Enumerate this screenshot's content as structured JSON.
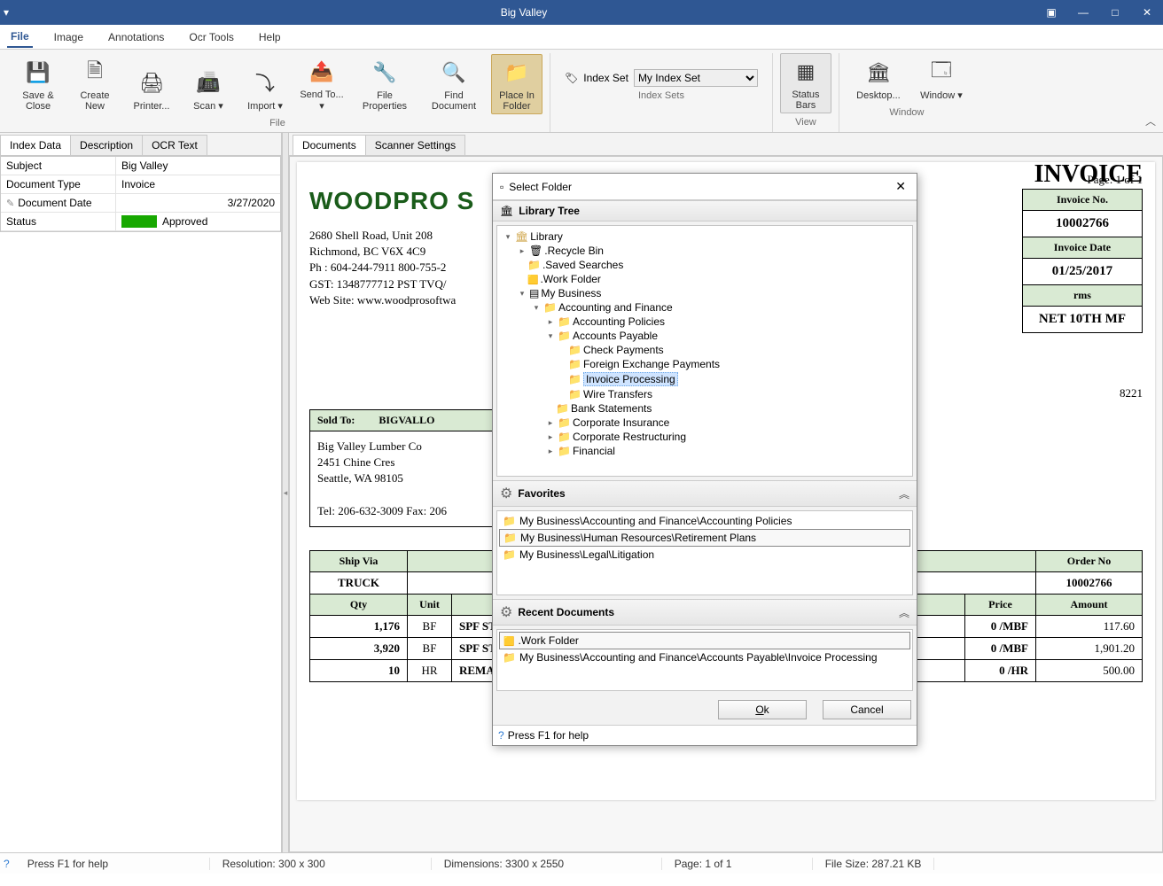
{
  "window": {
    "title": "Big Valley"
  },
  "menu": {
    "file": "File",
    "image": "Image",
    "annotations": "Annotations",
    "ocr": "Ocr Tools",
    "help": "Help"
  },
  "ribbon": {
    "file": {
      "save_close": "Save & Close",
      "create_new": "Create New",
      "printer": "Printer...",
      "scan": "Scan",
      "import": "Import",
      "send_to": "Send To...",
      "file_properties": "File Properties",
      "find_document": "Find Document",
      "place_in_folder": "Place In Folder",
      "group": "File"
    },
    "index": {
      "label": "Index Set",
      "value": "My Index Set",
      "group": "Index Sets"
    },
    "view": {
      "status_bars": "Status Bars",
      "group": "View"
    },
    "window": {
      "desktop": "Desktop...",
      "window": "Window",
      "group": "Window"
    }
  },
  "left_tabs": {
    "index_data": "Index Data",
    "description": "Description",
    "ocr_text": "OCR Text"
  },
  "index_grid": {
    "subject_k": "Subject",
    "subject_v": "Big Valley",
    "doctype_k": "Document Type",
    "doctype_v": "Invoice",
    "docdate_k": "Document Date",
    "docdate_v": "3/27/2020",
    "status_k": "Status",
    "status_v": "Approved"
  },
  "right_tabs": {
    "documents": "Documents",
    "scanner": "Scanner Settings"
  },
  "doc": {
    "pgno": "Page: 1 of 1",
    "logo": "WOODPRO S",
    "inv_heading": "INVOICE",
    "addr1": "2680 Shell Road, Unit 208",
    "addr2": "Richmond, BC  V6X 4C9",
    "addr3": "Ph  : 604-244-7911  800-755-2",
    "addr4": "GST: 1348777712   PST TVQ/",
    "addr5": "Web Site: www.woodprosoftwa",
    "inv_no_h": "Invoice No.",
    "inv_no": "10002766",
    "inv_date_h": "Invoice Date",
    "inv_date": "01/25/2017",
    "terms_h": "rms",
    "terms": "NET 10TH MF",
    "acct": "8221",
    "soldto_h": "Sold To:",
    "soldto_code": "BIGVALLO",
    "soldto_name": "Big Valley Lumber Co",
    "soldto_a1": "2451 Chine Cres",
    "soldto_a2": "Seattle, WA 98105",
    "soldto_tel": "Tel: 206-632-3009  Fax: 206",
    "shipvia_h": "Ship Via",
    "shipvia": "TRUCK",
    "orderno_h": "Order No",
    "orderno": "10002766",
    "cols": {
      "qty": "Qty",
      "unit": "Unit",
      "desc": "",
      "price": "Price",
      "amount": "Amount"
    },
    "rows": [
      {
        "qty": "1,176",
        "unit": "BF",
        "desc": "SPF STD &",
        "price": "0 /MBF",
        "amt": "117.60"
      },
      {
        "qty": "3,920",
        "unit": "BF",
        "desc": "SPF STD &",
        "price": "0 /MBF",
        "amt": "1,901.20"
      },
      {
        "qty": "10",
        "unit": "HR",
        "desc": "REMAN - C",
        "price": "0 /HR",
        "amt": "500.00"
      }
    ]
  },
  "dialog": {
    "title": "Select Folder",
    "lib_tree": "Library Tree",
    "nodes": {
      "library": "Library",
      "recycle": ".Recycle Bin",
      "saved": ".Saved Searches",
      "work": ".Work Folder",
      "mybiz": "My Business",
      "acctfin": "Accounting and Finance",
      "acctpol": "Accounting Policies",
      "ap": "Accounts Payable",
      "check": "Check Payments",
      "fx": "Foreign Exchange Payments",
      "invproc": "Invoice Processing",
      "wire": "Wire Transfers",
      "bank": "Bank Statements",
      "corpins": "Corporate Insurance",
      "corpres": "Corporate Restructuring",
      "fin": "Financial"
    },
    "fav_h": "Favorites",
    "fav1": "My Business\\Accounting and Finance\\Accounting Policies",
    "fav2": "My Business\\Human Resources\\Retirement Plans",
    "fav3": "My Business\\Legal\\Litigation",
    "rec_h": "Recent Documents",
    "rec1": ".Work Folder",
    "rec2": "My Business\\Accounting and Finance\\Accounts Payable\\Invoice Processing",
    "ok": "Ok",
    "cancel": "Cancel",
    "help": "Press F1 for help"
  },
  "status": {
    "help": "Press F1 for help",
    "res": "Resolution: 300 x 300",
    "dim": "Dimensions: 3300 x 2550",
    "page": "Page: 1 of 1",
    "size": "File Size: 287.21 KB"
  }
}
